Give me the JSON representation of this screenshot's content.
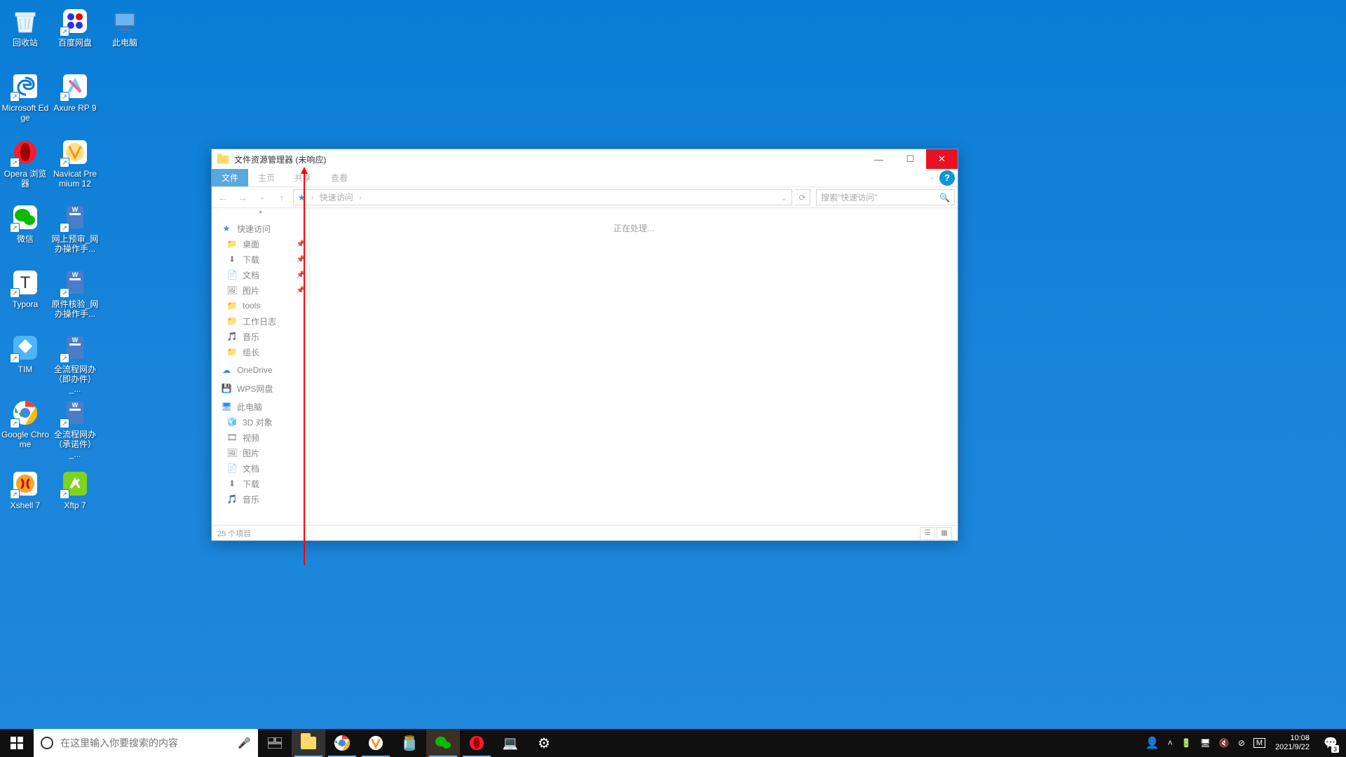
{
  "desktop_icons": [
    {
      "row": 0,
      "col": 0,
      "name": "recycle-bin",
      "label": "回收站",
      "kind": "bin"
    },
    {
      "row": 0,
      "col": 1,
      "name": "baidu-disk",
      "label": "百度网盘",
      "kind": "baidu"
    },
    {
      "row": 0,
      "col": 2,
      "name": "this-pc",
      "label": "此电脑",
      "kind": "pc"
    },
    {
      "row": 1,
      "col": 0,
      "name": "microsoft-edge",
      "label": "Microsoft Edge",
      "kind": "edge"
    },
    {
      "row": 1,
      "col": 1,
      "name": "axure-rp-9",
      "label": "Axure RP 9",
      "kind": "axure"
    },
    {
      "row": 2,
      "col": 0,
      "name": "opera",
      "label": "Opera 浏览器",
      "kind": "opera"
    },
    {
      "row": 2,
      "col": 1,
      "name": "navicat",
      "label": "Navicat Premium 12",
      "kind": "navicat"
    },
    {
      "row": 3,
      "col": 0,
      "name": "wechat",
      "label": "微信",
      "kind": "wechat"
    },
    {
      "row": 3,
      "col": 1,
      "name": "doc1",
      "label": "网上预审_网办操作手...",
      "kind": "wpsdoc"
    },
    {
      "row": 4,
      "col": 0,
      "name": "typora",
      "label": "Typora",
      "kind": "typora"
    },
    {
      "row": 4,
      "col": 1,
      "name": "doc2",
      "label": "原件核验_网办操作手...",
      "kind": "wpsdoc"
    },
    {
      "row": 5,
      "col": 0,
      "name": "tim",
      "label": "TIM",
      "kind": "tim"
    },
    {
      "row": 5,
      "col": 1,
      "name": "doc3",
      "label": "全流程网办（即办件）_...",
      "kind": "wpsdoc"
    },
    {
      "row": 6,
      "col": 0,
      "name": "google-chrome",
      "label": "Google Chrome",
      "kind": "chrome"
    },
    {
      "row": 6,
      "col": 1,
      "name": "doc4",
      "label": "全流程网办（承诺件）_...",
      "kind": "wpsdoc"
    },
    {
      "row": 7,
      "col": 0,
      "name": "xshell",
      "label": "Xshell 7",
      "kind": "xshell"
    },
    {
      "row": 7,
      "col": 1,
      "name": "xftp",
      "label": "Xftp 7",
      "kind": "xftp"
    }
  ],
  "explorer": {
    "title": "文件资源管理器 (未响应)",
    "tabs": {
      "file": "文件",
      "home": "主页",
      "share": "共享",
      "view": "查看"
    },
    "breadcrumb": "快速访问",
    "search_placeholder": "搜索\"快速访问\"",
    "processing": "正在处理...",
    "status": "25 个项目",
    "sidebar": {
      "quick": {
        "label": "快速访问",
        "items": [
          {
            "label": "桌面",
            "pin": true,
            "ic": "folder"
          },
          {
            "label": "下载",
            "pin": true,
            "ic": "download"
          },
          {
            "label": "文档",
            "pin": true,
            "ic": "doc"
          },
          {
            "label": "图片",
            "pin": true,
            "ic": "pic"
          },
          {
            "label": "tools",
            "pin": false,
            "ic": "folder"
          },
          {
            "label": "工作日志",
            "pin": false,
            "ic": "folder"
          },
          {
            "label": "音乐",
            "pin": false,
            "ic": "music"
          },
          {
            "label": "组长",
            "pin": false,
            "ic": "folder"
          }
        ]
      },
      "onedrive": "OneDrive",
      "wps": "WPS网盘",
      "thispc": {
        "label": "此电脑",
        "items": [
          {
            "label": "3D 对象",
            "ic": "3d"
          },
          {
            "label": "视频",
            "ic": "video"
          },
          {
            "label": "图片",
            "ic": "pic"
          },
          {
            "label": "文档",
            "ic": "doc"
          },
          {
            "label": "下载",
            "ic": "download"
          },
          {
            "label": "音乐",
            "ic": "music"
          }
        ]
      }
    }
  },
  "taskbar": {
    "search_placeholder": "在这里输入你要搜索的内容",
    "time": "10:08",
    "date": "2021/9/22",
    "notif_count": "3"
  }
}
